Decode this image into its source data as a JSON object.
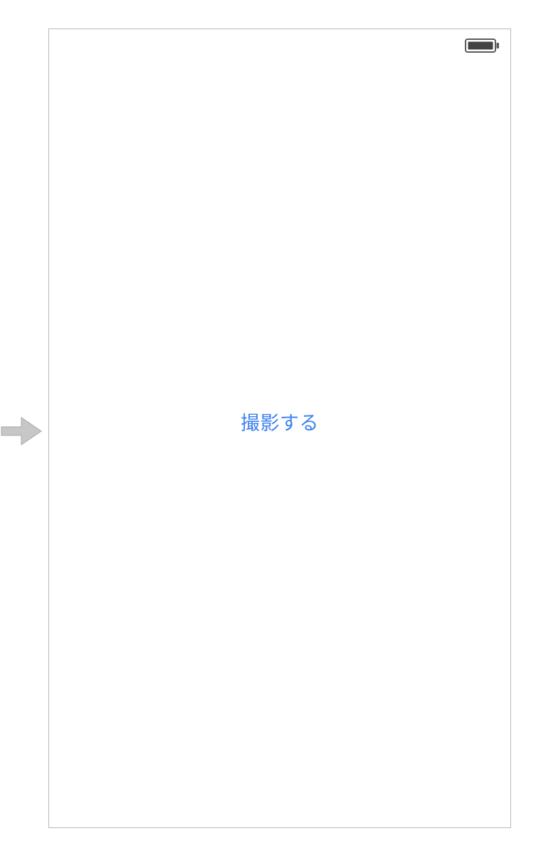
{
  "main": {
    "capture_button_label": "撮影する"
  },
  "status": {
    "battery_level": 100
  },
  "colors": {
    "link_blue": "#3d82f0",
    "frame_border": "#b8b8b8",
    "arrow_fill": "#c7c7c7",
    "battery_stroke": "#5a5a5a",
    "battery_fill": "#434343"
  }
}
